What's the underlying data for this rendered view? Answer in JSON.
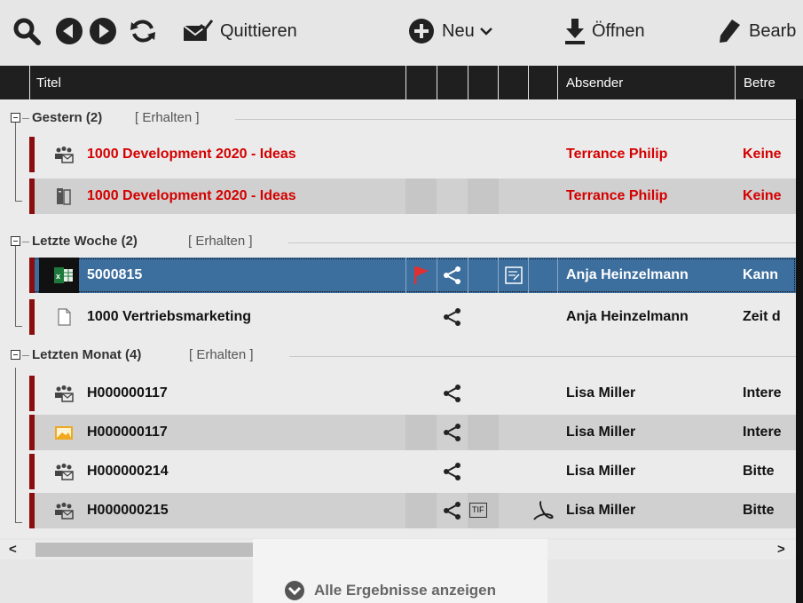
{
  "toolbar": {
    "buttons": [
      {
        "icon": "search-icon"
      },
      {
        "icon": "back-icon"
      },
      {
        "icon": "forward-icon"
      },
      {
        "icon": "refresh-icon"
      },
      {
        "icon": "envelope-check-icon",
        "label": "Quittieren"
      },
      {
        "icon": "plus-circle-icon",
        "label": "Neu"
      },
      {
        "icon": "download-icon",
        "label": "Öffnen"
      },
      {
        "icon": "pencil-icon",
        "label": "Bearb"
      }
    ]
  },
  "columns": {
    "title": "Titel",
    "sender": "Absender",
    "subject": "Betre"
  },
  "groups": [
    {
      "label": "Gestern (2)",
      "keep": "[ Erhalten ]"
    },
    {
      "label": "Letzte Woche (2)",
      "keep": "[ Erhalten ]"
    },
    {
      "label": "Letzten Monat (4)",
      "keep": "[ Erhalten ]"
    }
  ],
  "rows": [
    {
      "icon": "group-mail-icon",
      "title": "1000  Development 2020 - Ideas",
      "sender": "Terrance Philip",
      "subject": "Keine",
      "style": "red"
    },
    {
      "icon": "binder-icon",
      "title": "1000  Development 2020 - Ideas",
      "sender": "Terrance Philip",
      "subject": "Keine",
      "style": "red"
    },
    {
      "icon": "excel-icon",
      "title": "5000815",
      "sender": "Anja Heinzelmann",
      "subject": "Kann",
      "style": "selected",
      "flag": true,
      "share": true,
      "note": true
    },
    {
      "icon": "document-icon",
      "title": "1000  Vertriebsmarketing",
      "sender": "Anja Heinzelmann",
      "subject": "Zeit d",
      "style": "normal",
      "share": true
    },
    {
      "icon": "group-mail-icon",
      "title": "H000000117",
      "sender": "Lisa Miller",
      "subject": "Intere",
      "style": "normal",
      "share": true
    },
    {
      "icon": "image-icon",
      "title": "H000000117",
      "sender": "Lisa Miller",
      "subject": "Intere",
      "style": "normal",
      "share": true
    },
    {
      "icon": "group-mail-icon",
      "title": "H000000214",
      "sender": "Lisa Miller",
      "subject": "Bitte",
      "style": "normal",
      "share": true
    },
    {
      "icon": "group-mail-icon",
      "title": "H000000215",
      "sender": "Lisa Miller",
      "subject": "Bitte",
      "style": "normal",
      "share": true,
      "tif": "TIF",
      "pdf": true
    }
  ],
  "show_all": "Alle Ergebnisse anzeigen",
  "scroll": {
    "left": "<",
    "right": ">"
  },
  "colors": {
    "header_bg": "#1f1f1f",
    "selected_bg": "#3c6e9e",
    "unread_red": "#d40000",
    "marker": "#8b0d0d"
  }
}
